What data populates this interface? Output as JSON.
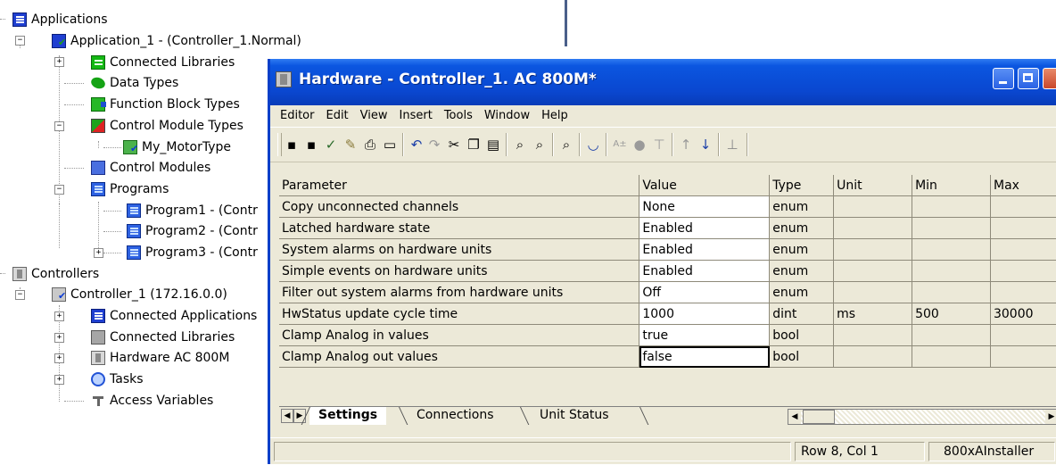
{
  "tree": {
    "applications": "Applications",
    "application_1": "Application_1 - (Controller_1.Normal)",
    "connected_libraries": "Connected Libraries",
    "data_types": "Data Types",
    "function_block_types": "Function Block Types",
    "control_module_types": "Control Module Types",
    "my_motortype": "My_MotorType",
    "control_modules": "Control Modules",
    "programs": "Programs",
    "program1": "Program1 - (Contr",
    "program2": "Program2 - (Contr",
    "program3": "Program3 - (Contr",
    "controllers": "Controllers",
    "controller_1": "Controller_1 (172.16.0.0)",
    "connected_applications": "Connected Applications",
    "ctrl_connected_libraries": "Connected Libraries",
    "hardware": "Hardware  AC 800M",
    "tasks": "Tasks",
    "access_variables": "Access Variables",
    "expander_minus": "−",
    "expander_plus": "+"
  },
  "window": {
    "title": "Hardware - Controller_1.  AC 800M*",
    "menu": [
      "Editor",
      "Edit",
      "View",
      "Insert",
      "Tools",
      "Window",
      "Help"
    ],
    "toolbar_icons": [
      "save-icon",
      "save-all-icon",
      "check-icon",
      "compile-icon",
      "print-icon",
      "print-preview-icon",
      "undo-icon",
      "redo-icon",
      "cut-icon",
      "copy-icon",
      "paste-icon",
      "find-icon",
      "find-next-icon",
      "replace-icon",
      "comment-icon",
      "format-icon",
      "bullet-icon",
      "tree-icon",
      "up-arrow-icon",
      "down-arrow-icon",
      "connect-icon"
    ]
  },
  "grid": {
    "columns": [
      "Parameter",
      "Value",
      "Type",
      "Unit",
      "Min",
      "Max"
    ],
    "rows": [
      {
        "parameter": "Copy unconnected channels",
        "value": "None",
        "type": "enum",
        "unit": "",
        "min": "",
        "max": ""
      },
      {
        "parameter": "Latched hardware state",
        "value": "Enabled",
        "type": "enum",
        "unit": "",
        "min": "",
        "max": ""
      },
      {
        "parameter": "System alarms on hardware units",
        "value": "Enabled",
        "type": "enum",
        "unit": "",
        "min": "",
        "max": ""
      },
      {
        "parameter": "Simple events on hardware units",
        "value": "Enabled",
        "type": "enum",
        "unit": "",
        "min": "",
        "max": ""
      },
      {
        "parameter": "Filter out system alarms from hardware units",
        "value": "Off",
        "type": "enum",
        "unit": "",
        "min": "",
        "max": ""
      },
      {
        "parameter": "HwStatus update cycle time",
        "value": "1000",
        "type": "dint",
        "unit": "ms",
        "min": "500",
        "max": "30000"
      },
      {
        "parameter": "Clamp Analog in values",
        "value": "true",
        "type": "bool",
        "unit": "",
        "min": "",
        "max": ""
      },
      {
        "parameter": "Clamp Analog out values",
        "value": "false",
        "type": "bool",
        "unit": "",
        "min": "",
        "max": ""
      }
    ],
    "selected_row": 7
  },
  "tabs": [
    "Settings",
    "Connections",
    "Unit Status"
  ],
  "active_tab": "Settings",
  "status": {
    "position": "Row 8, Col 1",
    "user": "800xAInstaller"
  },
  "colors": {
    "titlebar": "#0a47d0",
    "window_bg": "#ece9d8",
    "grid_line": "#8e8a7a"
  }
}
